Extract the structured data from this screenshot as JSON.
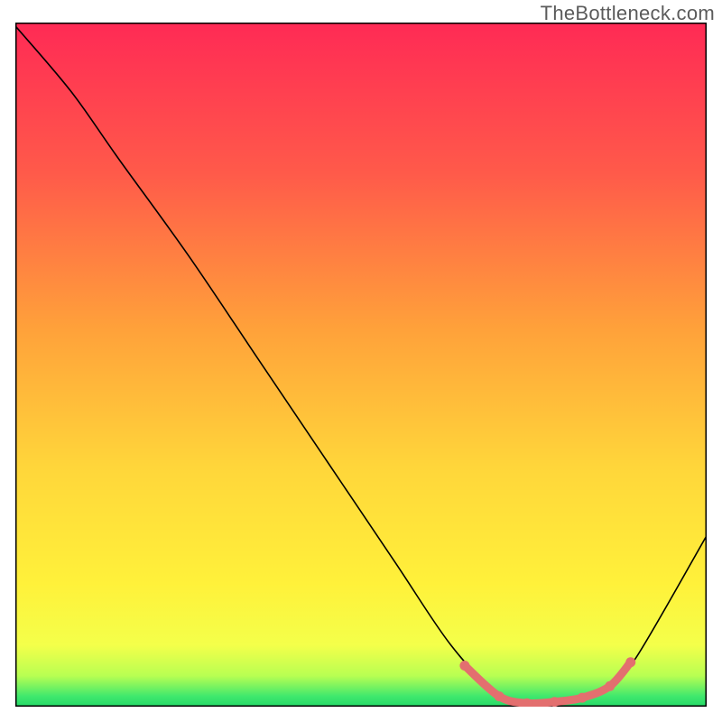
{
  "watermark": "TheBottleneck.com",
  "chart_data": {
    "type": "line",
    "title": "",
    "xlabel": "",
    "ylabel": "",
    "xlim": [
      0,
      100
    ],
    "ylim": [
      0,
      100
    ],
    "grid": false,
    "series": [
      {
        "name": "curve",
        "x": [
          0,
          8,
          15,
          25,
          35,
          45,
          55,
          63,
          70,
          74,
          78,
          82,
          86,
          90,
          100
        ],
        "y": [
          99.5,
          90,
          80,
          66,
          51,
          36,
          21,
          9,
          1.5,
          0.5,
          0.7,
          1.3,
          3,
          7.5,
          25
        ],
        "color": "#000000"
      },
      {
        "name": "highlight-segment",
        "x": [
          65,
          70,
          74,
          78,
          82,
          86,
          89
        ],
        "y": [
          6,
          1.5,
          0.5,
          0.7,
          1.3,
          3,
          6.5
        ],
        "color": "#e36f6f"
      }
    ],
    "gradient_stops": [
      {
        "offset": 0.0,
        "color": "#ff2a55"
      },
      {
        "offset": 0.22,
        "color": "#ff5a4a"
      },
      {
        "offset": 0.45,
        "color": "#ffa23a"
      },
      {
        "offset": 0.65,
        "color": "#ffd63a"
      },
      {
        "offset": 0.82,
        "color": "#fff13a"
      },
      {
        "offset": 0.91,
        "color": "#f4ff4a"
      },
      {
        "offset": 0.955,
        "color": "#b8ff52"
      },
      {
        "offset": 0.985,
        "color": "#3fe86d"
      },
      {
        "offset": 1.0,
        "color": "#25d968"
      }
    ]
  }
}
